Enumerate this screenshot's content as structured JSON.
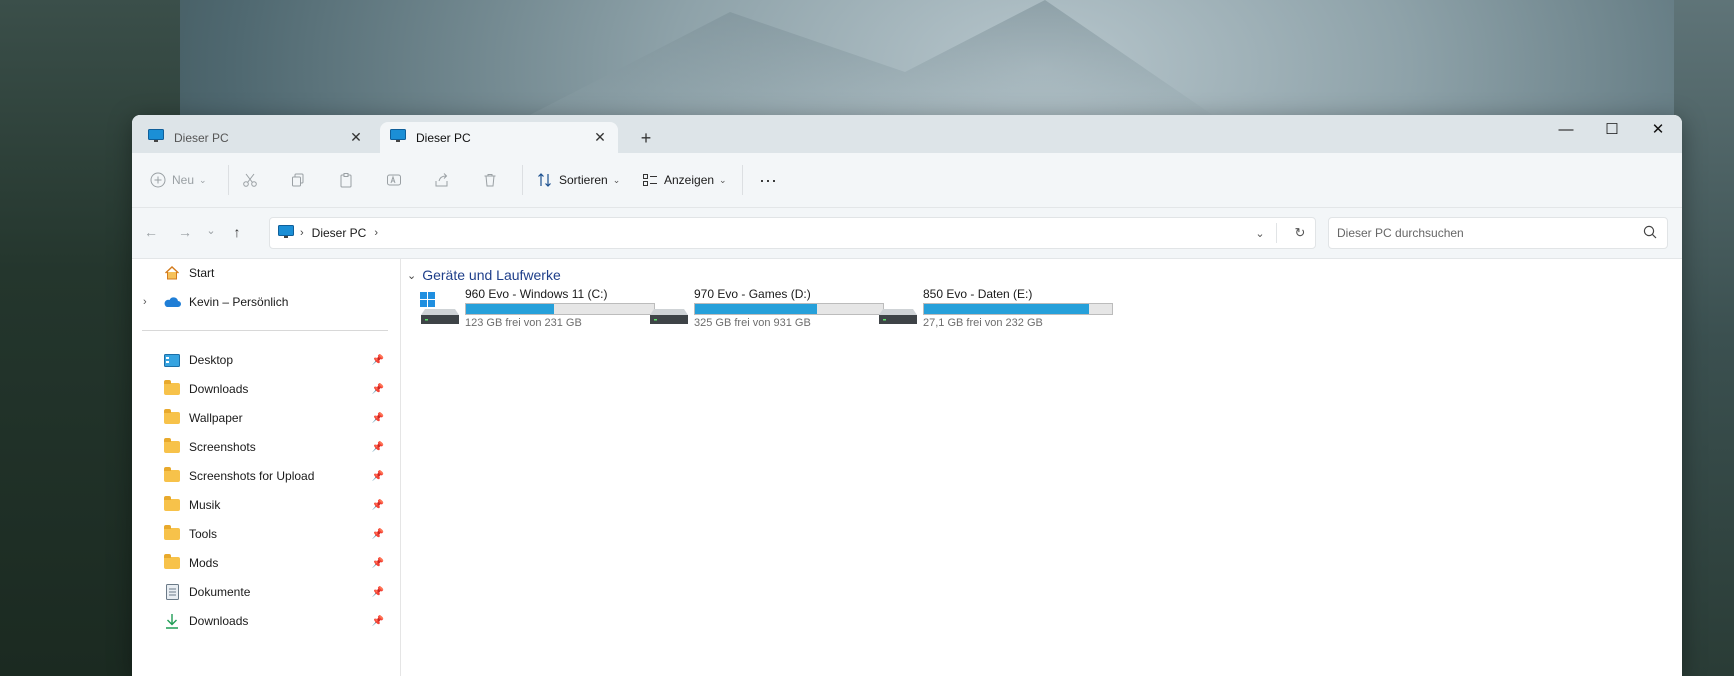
{
  "colors": {
    "accent": "#26a0da",
    "group_header": "#1f3f8a",
    "titlebar": "#dde4e8",
    "toolbar": "#f3f6f8"
  },
  "tabs": [
    {
      "label": "Dieser PC",
      "active": false,
      "icon": "monitor-icon"
    },
    {
      "label": "Dieser PC",
      "active": true,
      "icon": "monitor-icon"
    }
  ],
  "toolbar": {
    "new_label": "Neu",
    "sort_label": "Sortieren",
    "view_label": "Anzeigen"
  },
  "address": {
    "crumb": "Dieser PC"
  },
  "search": {
    "placeholder": "Dieser PC durchsuchen"
  },
  "sidebar": {
    "items": [
      {
        "label": "Start",
        "icon": "home-icon",
        "pinned": false
      },
      {
        "label": "Kevin – Persönlich",
        "icon": "onedrive-cloud-icon",
        "pinned": false
      },
      {
        "label": "Desktop",
        "icon": "desktop-icon",
        "pinned": true
      },
      {
        "label": "Downloads",
        "icon": "folder-icon",
        "pinned": true
      },
      {
        "label": "Wallpaper",
        "icon": "folder-icon",
        "pinned": true
      },
      {
        "label": "Screenshots",
        "icon": "folder-icon",
        "pinned": true
      },
      {
        "label": "Screenshots for Upload",
        "icon": "folder-icon",
        "pinned": true
      },
      {
        "label": "Musik",
        "icon": "folder-icon",
        "pinned": true
      },
      {
        "label": "Tools",
        "icon": "folder-icon",
        "pinned": true
      },
      {
        "label": "Mods",
        "icon": "folder-icon",
        "pinned": true
      },
      {
        "label": "Dokumente",
        "icon": "document-icon",
        "pinned": true
      },
      {
        "label": "Downloads",
        "icon": "download-arrow-icon",
        "pinned": true
      }
    ]
  },
  "content": {
    "group_title": "Geräte und Laufwerke",
    "drives": [
      {
        "name": "960 Evo - Windows 11 (C:)",
        "free_text": "123 GB frei von 231 GB",
        "used_fraction": 0.47,
        "system": true
      },
      {
        "name": "970 Evo - Games (D:)",
        "free_text": "325 GB frei von 931 GB",
        "used_fraction": 0.65,
        "system": false
      },
      {
        "name": "850 Evo - Daten (E:)",
        "free_text": "27,1 GB frei von 232 GB",
        "used_fraction": 0.88,
        "system": false
      }
    ]
  }
}
